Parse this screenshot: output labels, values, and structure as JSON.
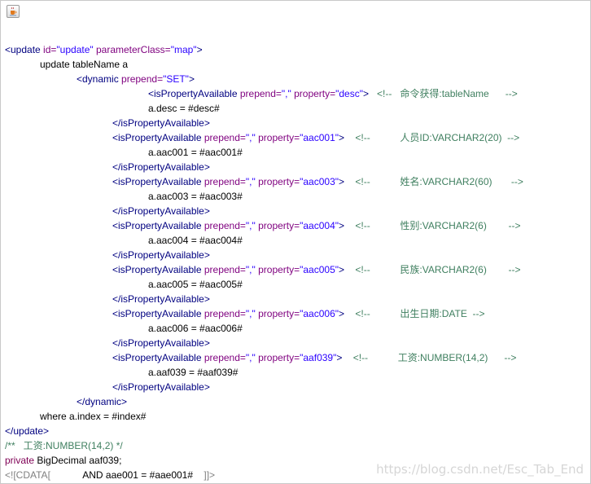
{
  "toolbar": {
    "java_icon": "java-cup-icon"
  },
  "lines": [
    {
      "indent": 0,
      "parts": [
        [
          "tag",
          "<update "
        ],
        [
          "attr",
          "id="
        ],
        [
          "val",
          "\"update\""
        ],
        [
          "txt",
          " "
        ],
        [
          "attr",
          "parameterClass="
        ],
        [
          "val",
          "\"map\""
        ],
        [
          "tag",
          ">"
        ]
      ]
    },
    {
      "indent": 1,
      "parts": [
        [
          "txt",
          "update tableName a"
        ]
      ]
    },
    {
      "indent": 2,
      "parts": [
        [
          "tag",
          "<dynamic "
        ],
        [
          "attr",
          "prepend="
        ],
        [
          "val",
          "\"SET\""
        ],
        [
          "tag",
          ">"
        ]
      ]
    },
    {
      "indent": 4,
      "parts": [
        [
          "tag",
          "<isPropertyAvailable "
        ],
        [
          "attr",
          "prepend="
        ],
        [
          "val",
          "\",\""
        ],
        [
          "txt",
          " "
        ],
        [
          "attr",
          "property="
        ],
        [
          "val",
          "\"desc\""
        ],
        [
          "tag",
          ">"
        ],
        [
          "cmt",
          "   <!--   命令获得:tableName      -->"
        ]
      ]
    },
    {
      "indent": 4,
      "parts": [
        [
          "txt",
          "a.desc = #desc#"
        ]
      ]
    },
    {
      "indent": 3,
      "parts": [
        [
          "tag",
          "</isPropertyAvailable>"
        ]
      ]
    },
    {
      "indent": 3,
      "parts": [
        [
          "tag",
          "<isPropertyAvailable "
        ],
        [
          "attr",
          "prepend="
        ],
        [
          "val",
          "\",\""
        ],
        [
          "txt",
          " "
        ],
        [
          "attr",
          "property="
        ],
        [
          "val",
          "\"aac001\""
        ],
        [
          "tag",
          ">"
        ],
        [
          "cmt",
          "    <!--           人员ID:VARCHAR2(20)  -->"
        ]
      ]
    },
    {
      "indent": 4,
      "parts": [
        [
          "txt",
          "a.aac001 = #aac001#"
        ]
      ]
    },
    {
      "indent": 3,
      "parts": [
        [
          "tag",
          "</isPropertyAvailable>"
        ]
      ]
    },
    {
      "indent": 3,
      "parts": [
        [
          "tag",
          "<isPropertyAvailable "
        ],
        [
          "attr",
          "prepend="
        ],
        [
          "val",
          "\",\""
        ],
        [
          "txt",
          " "
        ],
        [
          "attr",
          "property="
        ],
        [
          "val",
          "\"aac003\""
        ],
        [
          "tag",
          ">"
        ],
        [
          "cmt",
          "    <!--           姓名:VARCHAR2(60)       -->"
        ]
      ]
    },
    {
      "indent": 4,
      "parts": [
        [
          "txt",
          "a.aac003 = #aac003#"
        ]
      ]
    },
    {
      "indent": 3,
      "parts": [
        [
          "tag",
          "</isPropertyAvailable>"
        ]
      ]
    },
    {
      "indent": 3,
      "parts": [
        [
          "tag",
          "<isPropertyAvailable "
        ],
        [
          "attr",
          "prepend="
        ],
        [
          "val",
          "\",\""
        ],
        [
          "txt",
          " "
        ],
        [
          "attr",
          "property="
        ],
        [
          "val",
          "\"aac004\""
        ],
        [
          "tag",
          ">"
        ],
        [
          "cmt",
          "    <!--           性别:VARCHAR2(6)        -->"
        ]
      ]
    },
    {
      "indent": 4,
      "parts": [
        [
          "txt",
          "a.aac004 = #aac004#"
        ]
      ]
    },
    {
      "indent": 3,
      "parts": [
        [
          "tag",
          "</isPropertyAvailable>"
        ]
      ]
    },
    {
      "indent": 3,
      "parts": [
        [
          "tag",
          "<isPropertyAvailable "
        ],
        [
          "attr",
          "prepend="
        ],
        [
          "val",
          "\",\""
        ],
        [
          "txt",
          " "
        ],
        [
          "attr",
          "property="
        ],
        [
          "val",
          "\"aac005\""
        ],
        [
          "tag",
          ">"
        ],
        [
          "cmt",
          "    <!--           民族:VARCHAR2(6)        -->"
        ]
      ]
    },
    {
      "indent": 4,
      "parts": [
        [
          "txt",
          "a.aac005 = #aac005#"
        ]
      ]
    },
    {
      "indent": 3,
      "parts": [
        [
          "tag",
          "</isPropertyAvailable>"
        ]
      ]
    },
    {
      "indent": 3,
      "parts": [
        [
          "tag",
          "<isPropertyAvailable "
        ],
        [
          "attr",
          "prepend="
        ],
        [
          "val",
          "\",\""
        ],
        [
          "txt",
          " "
        ],
        [
          "attr",
          "property="
        ],
        [
          "val",
          "\"aac006\""
        ],
        [
          "tag",
          ">"
        ],
        [
          "cmt",
          "    <!--           出生日期:DATE  -->"
        ]
      ]
    },
    {
      "indent": 4,
      "parts": [
        [
          "txt",
          "a.aac006 = #aac006#"
        ]
      ]
    },
    {
      "indent": 3,
      "parts": [
        [
          "tag",
          "</isPropertyAvailable>"
        ]
      ]
    },
    {
      "indent": 3,
      "parts": [
        [
          "tag",
          "<isPropertyAvailable "
        ],
        [
          "attr",
          "prepend="
        ],
        [
          "val",
          "\",\""
        ],
        [
          "txt",
          " "
        ],
        [
          "attr",
          "property="
        ],
        [
          "val",
          "\"aaf039\""
        ],
        [
          "tag",
          ">"
        ],
        [
          "cmt",
          "    <!--           工资:NUMBER(14,2)      -->"
        ]
      ]
    },
    {
      "indent": 4,
      "parts": [
        [
          "txt",
          "a.aaf039 = #aaf039#"
        ]
      ]
    },
    {
      "indent": 3,
      "parts": [
        [
          "tag",
          "</isPropertyAvailable>"
        ]
      ]
    },
    {
      "indent": 2,
      "parts": [
        [
          "tag",
          "</dynamic>"
        ]
      ]
    },
    {
      "indent": 1,
      "parts": [
        [
          "txt",
          "where a.index = #index#"
        ]
      ]
    },
    {
      "indent": 0,
      "parts": [
        [
          "tag",
          "</update>"
        ]
      ]
    },
    {
      "indent": 0,
      "parts": [
        [
          "jcmt",
          "/**   工资:NUMBER(14,2) */"
        ]
      ]
    },
    {
      "indent": 0,
      "parts": [
        [
          "kw",
          "private"
        ],
        [
          "txt",
          " BigDecimal aaf039;"
        ]
      ]
    },
    {
      "indent": 0,
      "parts": [
        [
          "cdata",
          "<![CDATA["
        ],
        [
          "txt",
          "            AND aae001 = #aae001#    "
        ],
        [
          "cdata",
          "]]>"
        ]
      ]
    }
  ],
  "watermark": "https://blog.csdn.net/Esc_Tab_End"
}
